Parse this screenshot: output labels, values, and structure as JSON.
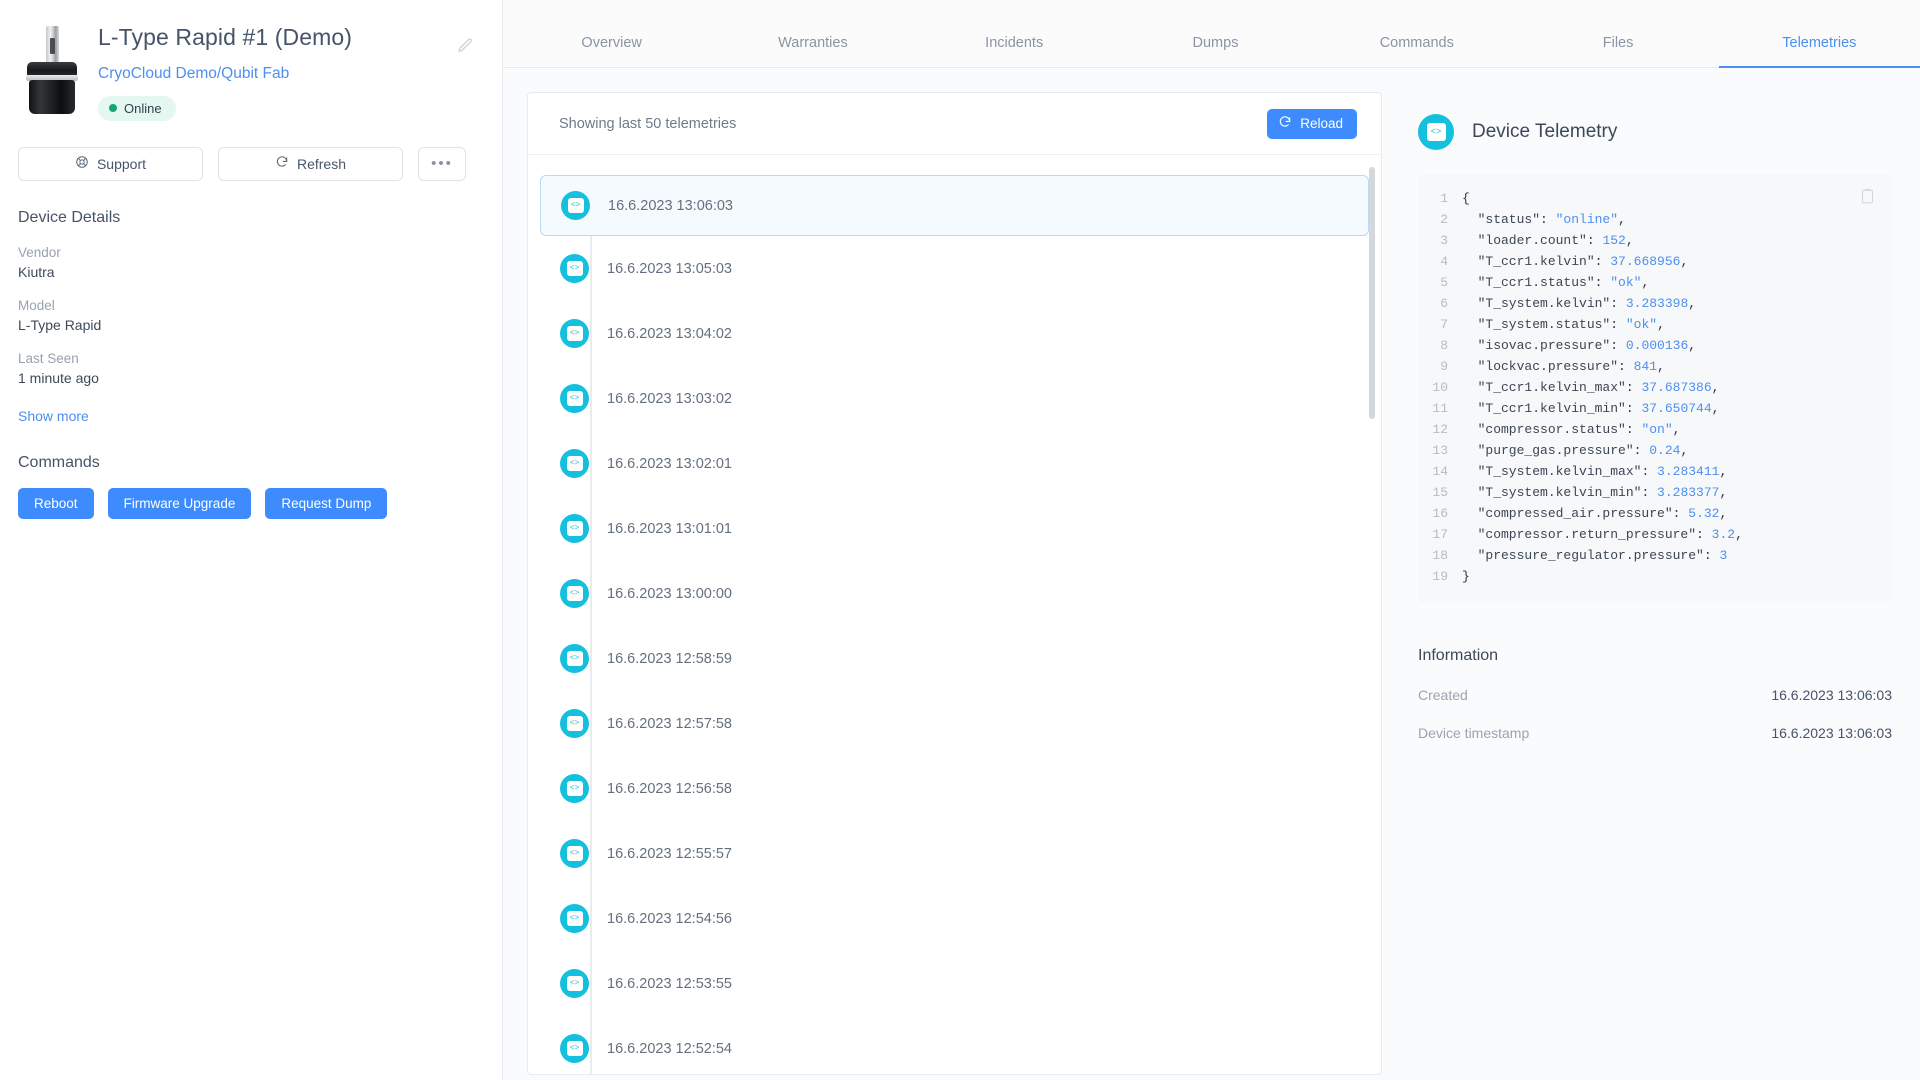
{
  "device": {
    "name": "L-Type Rapid #1 (Demo)",
    "path": "CryoCloud Demo/Qubit Fab",
    "status": "Online",
    "thumbnail_icon": "cryostat-device-image",
    "edit_icon": "pencil-icon",
    "actions": {
      "support_label": "Support",
      "support_icon": "lifebuoy-icon",
      "refresh_label": "Refresh",
      "refresh_icon": "refresh-icon",
      "more_label": "•••"
    },
    "details_title": "Device Details",
    "details": [
      {
        "label": "Vendor",
        "value": "Kiutra"
      },
      {
        "label": "Model",
        "value": "L-Type Rapid"
      },
      {
        "label": "Last Seen",
        "value": "1 minute ago"
      }
    ],
    "show_more_label": "Show more",
    "commands_title": "Commands",
    "commands": [
      {
        "label": "Reboot"
      },
      {
        "label": "Firmware Upgrade"
      },
      {
        "label": "Request Dump"
      }
    ]
  },
  "tabs": [
    {
      "label": "Overview",
      "active": false
    },
    {
      "label": "Warranties",
      "active": false
    },
    {
      "label": "Incidents",
      "active": false
    },
    {
      "label": "Dumps",
      "active": false
    },
    {
      "label": "Commands",
      "active": false
    },
    {
      "label": "Files",
      "active": false
    },
    {
      "label": "Telemetries",
      "active": true
    }
  ],
  "telemetry_list": {
    "header_text": "Showing last 50 telemetries",
    "reload_label": "Reload",
    "reload_icon": "refresh-icon",
    "item_icon": "code-braces-icon",
    "items": [
      {
        "timestamp": "16.6.2023 13:06:03",
        "selected": true
      },
      {
        "timestamp": "16.6.2023 13:05:03",
        "selected": false
      },
      {
        "timestamp": "16.6.2023 13:04:02",
        "selected": false
      },
      {
        "timestamp": "16.6.2023 13:03:02",
        "selected": false
      },
      {
        "timestamp": "16.6.2023 13:02:01",
        "selected": false
      },
      {
        "timestamp": "16.6.2023 13:01:01",
        "selected": false
      },
      {
        "timestamp": "16.6.2023 13:00:00",
        "selected": false
      },
      {
        "timestamp": "16.6.2023 12:58:59",
        "selected": false
      },
      {
        "timestamp": "16.6.2023 12:57:58",
        "selected": false
      },
      {
        "timestamp": "16.6.2023 12:56:58",
        "selected": false
      },
      {
        "timestamp": "16.6.2023 12:55:57",
        "selected": false
      },
      {
        "timestamp": "16.6.2023 12:54:56",
        "selected": false
      },
      {
        "timestamp": "16.6.2023 12:53:55",
        "selected": false
      },
      {
        "timestamp": "16.6.2023 12:52:54",
        "selected": false
      }
    ]
  },
  "detail": {
    "title": "Device Telemetry",
    "title_icon": "code-braces-icon",
    "copy_icon": "clipboard-icon",
    "code_lines": [
      {
        "n": "1",
        "segments": [
          {
            "t": "{",
            "c": "ctext"
          }
        ]
      },
      {
        "n": "2",
        "segments": [
          {
            "t": "  \"status\"",
            "c": "k"
          },
          {
            "t": ": ",
            "c": "ctext"
          },
          {
            "t": "\"online\"",
            "c": "s"
          },
          {
            "t": ",",
            "c": "ctext"
          }
        ]
      },
      {
        "n": "3",
        "segments": [
          {
            "t": "  \"loader.count\"",
            "c": "k"
          },
          {
            "t": ": ",
            "c": "ctext"
          },
          {
            "t": "152",
            "c": "n"
          },
          {
            "t": ",",
            "c": "ctext"
          }
        ]
      },
      {
        "n": "4",
        "segments": [
          {
            "t": "  \"T_ccr1.kelvin\"",
            "c": "k"
          },
          {
            "t": ": ",
            "c": "ctext"
          },
          {
            "t": "37.668956",
            "c": "n"
          },
          {
            "t": ",",
            "c": "ctext"
          }
        ]
      },
      {
        "n": "5",
        "segments": [
          {
            "t": "  \"T_ccr1.status\"",
            "c": "k"
          },
          {
            "t": ": ",
            "c": "ctext"
          },
          {
            "t": "\"ok\"",
            "c": "s"
          },
          {
            "t": ",",
            "c": "ctext"
          }
        ]
      },
      {
        "n": "6",
        "segments": [
          {
            "t": "  \"T_system.kelvin\"",
            "c": "k"
          },
          {
            "t": ": ",
            "c": "ctext"
          },
          {
            "t": "3.283398",
            "c": "n"
          },
          {
            "t": ",",
            "c": "ctext"
          }
        ]
      },
      {
        "n": "7",
        "segments": [
          {
            "t": "  \"T_system.status\"",
            "c": "k"
          },
          {
            "t": ": ",
            "c": "ctext"
          },
          {
            "t": "\"ok\"",
            "c": "s"
          },
          {
            "t": ",",
            "c": "ctext"
          }
        ]
      },
      {
        "n": "8",
        "segments": [
          {
            "t": "  \"isovac.pressure\"",
            "c": "k"
          },
          {
            "t": ": ",
            "c": "ctext"
          },
          {
            "t": "0.000136",
            "c": "n"
          },
          {
            "t": ",",
            "c": "ctext"
          }
        ]
      },
      {
        "n": "9",
        "segments": [
          {
            "t": "  \"lockvac.pressure\"",
            "c": "k"
          },
          {
            "t": ": ",
            "c": "ctext"
          },
          {
            "t": "841",
            "c": "n"
          },
          {
            "t": ",",
            "c": "ctext"
          }
        ]
      },
      {
        "n": "10",
        "segments": [
          {
            "t": "  \"T_ccr1.kelvin_max\"",
            "c": "k"
          },
          {
            "t": ": ",
            "c": "ctext"
          },
          {
            "t": "37.687386",
            "c": "n"
          },
          {
            "t": ",",
            "c": "ctext"
          }
        ]
      },
      {
        "n": "11",
        "segments": [
          {
            "t": "  \"T_ccr1.kelvin_min\"",
            "c": "k"
          },
          {
            "t": ": ",
            "c": "ctext"
          },
          {
            "t": "37.650744",
            "c": "n"
          },
          {
            "t": ",",
            "c": "ctext"
          }
        ]
      },
      {
        "n": "12",
        "segments": [
          {
            "t": "  \"compressor.status\"",
            "c": "k"
          },
          {
            "t": ": ",
            "c": "ctext"
          },
          {
            "t": "\"on\"",
            "c": "s"
          },
          {
            "t": ",",
            "c": "ctext"
          }
        ]
      },
      {
        "n": "13",
        "segments": [
          {
            "t": "  \"purge_gas.pressure\"",
            "c": "k"
          },
          {
            "t": ": ",
            "c": "ctext"
          },
          {
            "t": "0.24",
            "c": "n"
          },
          {
            "t": ",",
            "c": "ctext"
          }
        ]
      },
      {
        "n": "14",
        "segments": [
          {
            "t": "  \"T_system.kelvin_max\"",
            "c": "k"
          },
          {
            "t": ": ",
            "c": "ctext"
          },
          {
            "t": "3.283411",
            "c": "n"
          },
          {
            "t": ",",
            "c": "ctext"
          }
        ]
      },
      {
        "n": "15",
        "segments": [
          {
            "t": "  \"T_system.kelvin_min\"",
            "c": "k"
          },
          {
            "t": ": ",
            "c": "ctext"
          },
          {
            "t": "3.283377",
            "c": "n"
          },
          {
            "t": ",",
            "c": "ctext"
          }
        ]
      },
      {
        "n": "16",
        "segments": [
          {
            "t": "  \"compressed_air.pressure\"",
            "c": "k"
          },
          {
            "t": ": ",
            "c": "ctext"
          },
          {
            "t": "5.32",
            "c": "n"
          },
          {
            "t": ",",
            "c": "ctext"
          }
        ]
      },
      {
        "n": "17",
        "segments": [
          {
            "t": "  \"compressor.return_pressure\"",
            "c": "k"
          },
          {
            "t": ": ",
            "c": "ctext"
          },
          {
            "t": "3.2",
            "c": "n"
          },
          {
            "t": ",",
            "c": "ctext"
          }
        ]
      },
      {
        "n": "18",
        "segments": [
          {
            "t": "  \"pressure_regulator.pressure\"",
            "c": "k"
          },
          {
            "t": ": ",
            "c": "ctext"
          },
          {
            "t": "3",
            "c": "n"
          }
        ]
      },
      {
        "n": "19",
        "segments": [
          {
            "t": "}",
            "c": "ctext"
          }
        ]
      }
    ],
    "information_title": "Information",
    "information": [
      {
        "label": "Created",
        "value": "16.6.2023 13:06:03"
      },
      {
        "label": "Device timestamp",
        "value": "16.6.2023 13:06:03"
      }
    ]
  },
  "colors": {
    "accent_blue": "#3d8bfd",
    "link_blue": "#4d8ff0",
    "telemetry_cyan": "#14c0dd",
    "status_green": "#12a76f",
    "status_bg": "#e4f7f0"
  }
}
